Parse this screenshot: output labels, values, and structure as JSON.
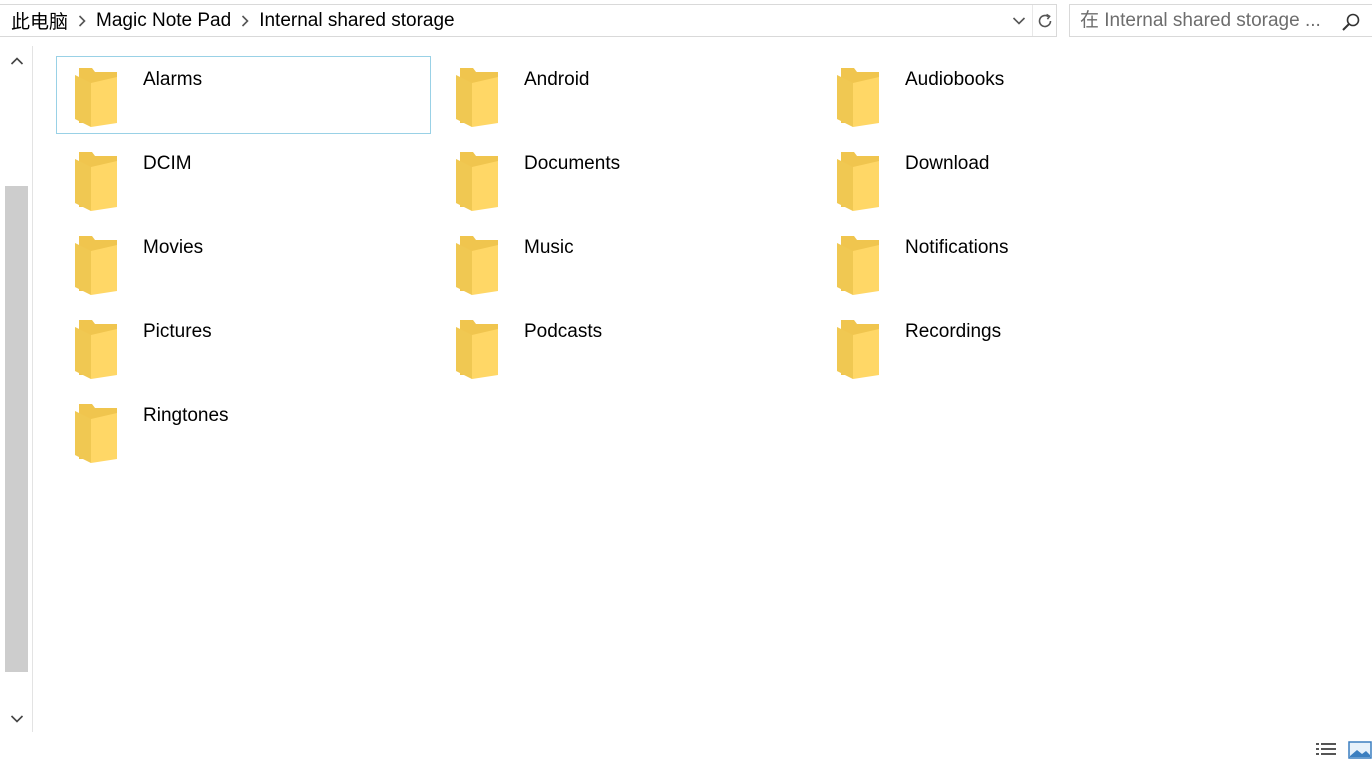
{
  "breadcrumb": [
    "此电脑",
    "Magic Note Pad",
    "Internal shared storage"
  ],
  "search": {
    "placeholder": "在 Internal shared storage ..."
  },
  "icons": {
    "breadcrumb_separator": "chevron-right-icon",
    "dropdown": "chevron-down-icon",
    "refresh": "refresh-icon",
    "search": "search-icon",
    "folder": "folder-icon"
  },
  "colors": {
    "selection_border": "#99d1e6",
    "folder_front": "#ffd766",
    "folder_back": "#f0c54e"
  },
  "folders": [
    {
      "name": "Alarms",
      "selected": true
    },
    {
      "name": "Android"
    },
    {
      "name": "Audiobooks"
    },
    {
      "name": "DCIM"
    },
    {
      "name": "Documents"
    },
    {
      "name": "Download"
    },
    {
      "name": "Movies"
    },
    {
      "name": "Music"
    },
    {
      "name": "Notifications"
    },
    {
      "name": "Pictures"
    },
    {
      "name": "Podcasts"
    },
    {
      "name": "Recordings"
    },
    {
      "name": "Ringtones"
    }
  ]
}
